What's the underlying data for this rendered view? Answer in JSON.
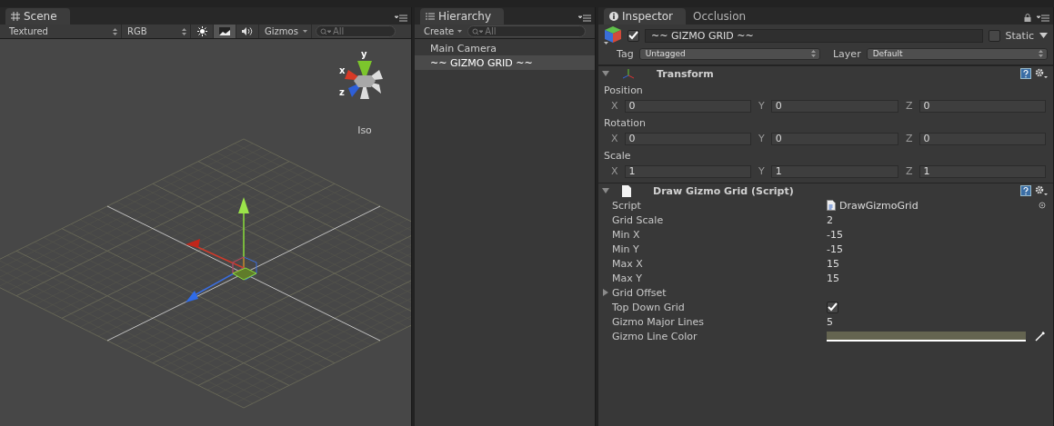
{
  "scene": {
    "tab": "Scene",
    "toolbar": {
      "shading": "Textured",
      "render_mode": "RGB",
      "toggles": [
        {
          "kind": "light",
          "on": false
        },
        {
          "kind": "image",
          "on": true
        },
        {
          "kind": "audio",
          "on": false
        }
      ],
      "gizmos": "Gizmos",
      "search": {
        "placeholder": "All"
      }
    },
    "orientation_gizmo": {
      "axes": [
        {
          "label": "y"
        },
        {
          "label": "x"
        },
        {
          "label": "z"
        }
      ],
      "projection": "Iso"
    }
  },
  "hierarchy": {
    "tab": "Hierarchy",
    "create": "Create",
    "search": {
      "placeholder": "All"
    },
    "items": [
      {
        "label": "Main Camera",
        "selected": false
      },
      {
        "label": "~~ GIZMO GRID ~~",
        "selected": true
      }
    ]
  },
  "inspector": {
    "tabs": [
      {
        "label": "Inspector",
        "selected": true
      },
      {
        "label": "Occlusion",
        "selected": false
      }
    ],
    "object": {
      "active": true,
      "name": "~~ GIZMO GRID ~~",
      "static_label": "Static",
      "static": false,
      "tag_label": "Tag",
      "tag": "Untagged",
      "layer_label": "Layer",
      "layer": "Default"
    },
    "components": [
      {
        "kind": "transform",
        "title": "Transform",
        "expanded": true,
        "rows": [
          {
            "label": "Position",
            "fields": [
              {
                "axis": "X",
                "value": "0"
              },
              {
                "axis": "Y",
                "value": "0"
              },
              {
                "axis": "Z",
                "value": "0"
              }
            ]
          },
          {
            "label": "Rotation",
            "fields": [
              {
                "axis": "X",
                "value": "0"
              },
              {
                "axis": "Y",
                "value": "0"
              },
              {
                "axis": "Z",
                "value": "0"
              }
            ]
          },
          {
            "label": "Scale",
            "fields": [
              {
                "axis": "X",
                "value": "1"
              },
              {
                "axis": "Y",
                "value": "1"
              },
              {
                "axis": "Z",
                "value": "1"
              }
            ]
          }
        ]
      },
      {
        "kind": "script",
        "title": "Draw Gizmo Grid (Script)",
        "expanded": true,
        "properties": [
          {
            "kind": "object",
            "label": "Script",
            "value": "DrawGizmoGrid"
          },
          {
            "kind": "value",
            "label": "Grid Scale",
            "value": "2"
          },
          {
            "kind": "value",
            "label": "Min X",
            "value": "-15"
          },
          {
            "kind": "value",
            "label": "Min Y",
            "value": "-15"
          },
          {
            "kind": "value",
            "label": "Max X",
            "value": "15"
          },
          {
            "kind": "value",
            "label": "Max Y",
            "value": "15"
          },
          {
            "kind": "foldout",
            "label": "Grid Offset",
            "expanded": false
          },
          {
            "kind": "checkbox",
            "label": "Top Down Grid",
            "checked": true
          },
          {
            "kind": "value",
            "label": "Gizmo Major Lines",
            "value": "5"
          },
          {
            "kind": "color",
            "label": "Gizmo Line Color",
            "color": "#646450"
          }
        ]
      }
    ]
  }
}
